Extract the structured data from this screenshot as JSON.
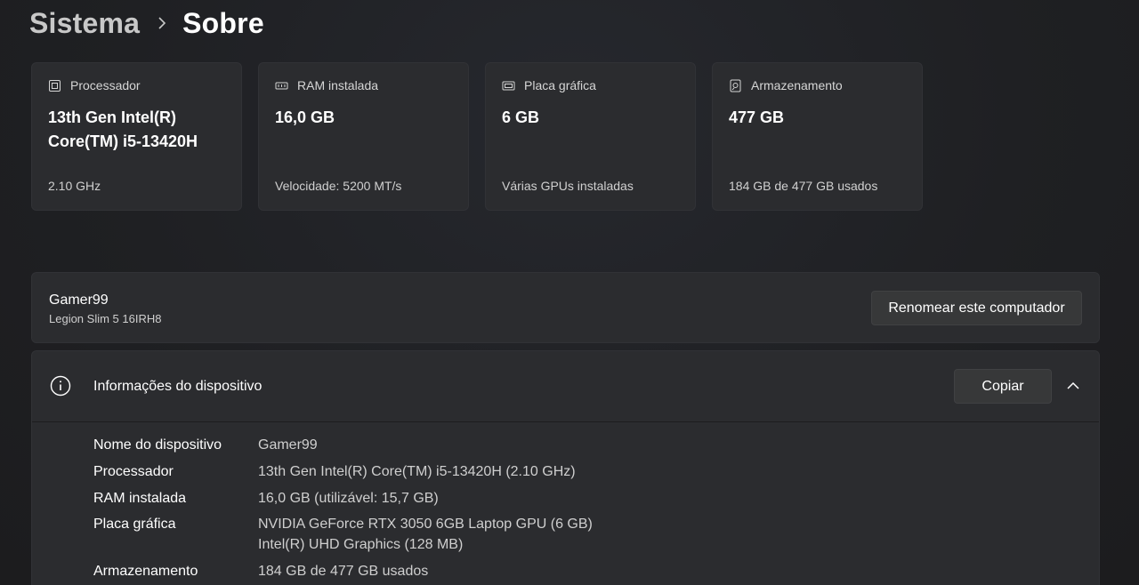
{
  "breadcrumb": {
    "parent": "Sistema",
    "current": "Sobre"
  },
  "cards": [
    {
      "icon": "processor-icon",
      "title": "Processador",
      "value_line1": "13th Gen Intel(R)",
      "value_line2": "Core(TM) i5-13420H",
      "sub": "2.10 GHz"
    },
    {
      "icon": "ram-icon",
      "title": "RAM instalada",
      "value_line1": "16,0 GB",
      "value_line2": "",
      "sub": "Velocidade: 5200 MT/s"
    },
    {
      "icon": "graphics-card-icon",
      "title": "Placa gráfica",
      "value_line1": "6 GB",
      "value_line2": "",
      "sub": "Várias GPUs instaladas"
    },
    {
      "icon": "storage-icon",
      "title": "Armazenamento",
      "value_line1": "477 GB",
      "value_line2": "",
      "sub": "184 GB de 477 GB usados"
    }
  ],
  "device": {
    "name": "Gamer99",
    "model": "Legion Slim 5 16IRH8",
    "rename_label": "Renomear este computador"
  },
  "info": {
    "title": "Informações do dispositivo",
    "copy_label": "Copiar",
    "specs": [
      {
        "label": "Nome do dispositivo",
        "value": "Gamer99"
      },
      {
        "label": "Processador",
        "value": "13th Gen Intel(R) Core(TM) i5-13420H (2.10 GHz)"
      },
      {
        "label": "RAM instalada",
        "value": "16,0 GB (utilizável: 15,7 GB)"
      },
      {
        "label": "Placa gráfica",
        "value": "NVIDIA GeForce RTX 3050 6GB Laptop GPU (6 GB)",
        "value2": "Intel(R) UHD Graphics (128 MB)"
      },
      {
        "label": "Armazenamento",
        "value": "184 GB de 477 GB usados"
      }
    ]
  }
}
